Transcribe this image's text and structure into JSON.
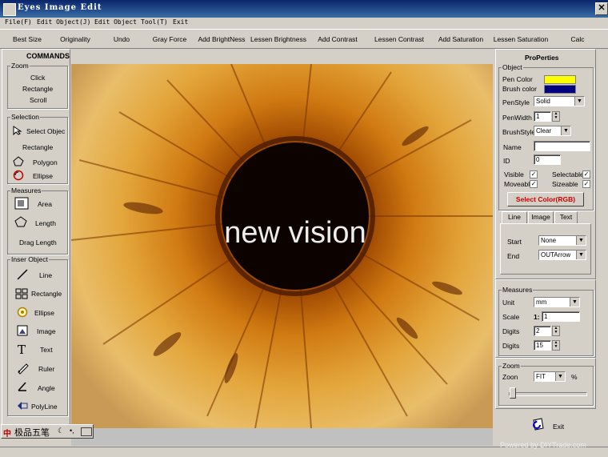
{
  "window": {
    "title": "Eyes Image Edit",
    "close_glyph": "✕"
  },
  "menu": [
    "File(F)",
    "Edit Object(J)",
    "Edit Object",
    "Tool(T)",
    "Exit"
  ],
  "toolbar": [
    "Best Size",
    "Originality",
    "Undo",
    "Gray Force",
    "Add BrightNess",
    "Lessen Brightness",
    "Add Contrast",
    "Lessen Contrast",
    "Add Saturation",
    "Lessen Saturation",
    "Calc"
  ],
  "commands": {
    "title": "COMMANDS",
    "zoom": {
      "title": "Zoom",
      "items": [
        "Click",
        "Rectangle",
        "Scroll"
      ]
    },
    "selection": {
      "title": "Selection",
      "items": [
        "Select Objec",
        "Rectangle",
        "Polygon",
        "Ellipse"
      ]
    },
    "measures": {
      "title": "Measures",
      "items": [
        "Area",
        "Length",
        "Drag Length"
      ]
    },
    "insert": {
      "title": "Inser Object",
      "items": [
        "Line",
        "Rectangle",
        "Ellipse",
        "Image",
        "Text",
        "Ruler",
        "Angle",
        "PolyLine"
      ]
    }
  },
  "canvas": {
    "watermark": "new vision"
  },
  "properties": {
    "title": "ProPerties",
    "object_title": "Object",
    "pen_color_label": "Pen Color",
    "pen_color": "#ffff00",
    "brush_color_label": "Brush color",
    "brush_color": "#000080",
    "pen_style_label": "PenStyle",
    "pen_style": "Solid",
    "pen_width_label": "PenWidth",
    "pen_width": "1",
    "brush_style_label": "BrushStyle",
    "brush_style": "Clear",
    "name_label": "Name",
    "name_value": "",
    "id_label": "ID",
    "id_value": "0",
    "visible_label": "Visible",
    "selectable_label": "Selectable",
    "moveable_label": "Moveabl",
    "sizeable_label": "Sizeable",
    "check_glyph": "✓",
    "select_color_button": "Select Color(RGB)",
    "tabs": [
      "Line",
      "Image",
      "Text"
    ],
    "start_label": "Start",
    "start_value": "None",
    "end_label": "End",
    "end_value": "OUTArrow"
  },
  "measures": {
    "title": "Measures",
    "unit_label": "Unit",
    "unit_value": "mm",
    "scale_label": "Scale",
    "scale_prefix": "1:",
    "scale_value": "1",
    "digits_label": "Digits",
    "digits1": "2",
    "digits2": "15"
  },
  "zoom": {
    "title": "Zoom",
    "zoom_label": "Zoon",
    "zoom_value": "FIT",
    "percent": "%"
  },
  "exit_label": "Exit",
  "ime": {
    "label": "极品五笔"
  },
  "footer_watermark": "Powered by DIYTrade.com",
  "colors": {
    "window_bg": "#d4d0c8",
    "title_bg": "#0a246a",
    "select_color_text": "#cc0000"
  }
}
